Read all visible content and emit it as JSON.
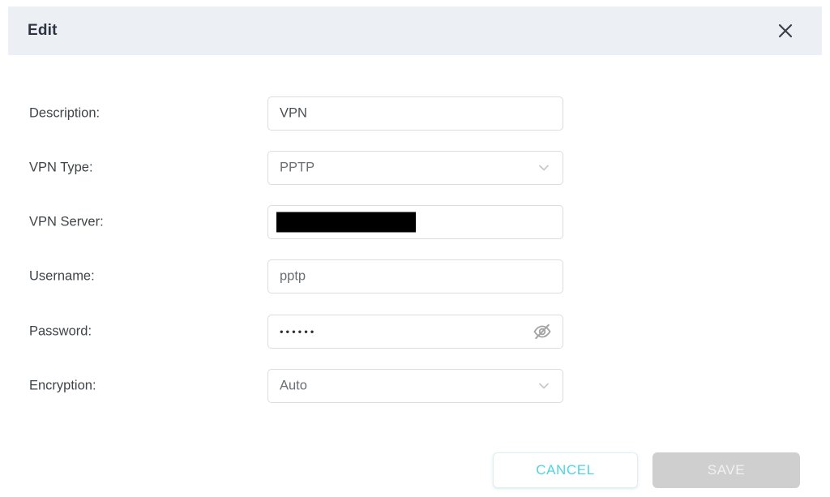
{
  "dialog": {
    "title": "Edit",
    "close_icon": "close-x-icon"
  },
  "form": {
    "rows": [
      {
        "label": "Description:",
        "type": "text",
        "value": "VPN",
        "name": "description"
      },
      {
        "label": "VPN Type:",
        "type": "select",
        "value": "PPTP",
        "name": "vpn-type",
        "chevron_icon": "chevron-down-icon"
      },
      {
        "label": "VPN Server:",
        "type": "redacted",
        "value": "",
        "name": "vpn-server"
      },
      {
        "label": "Username:",
        "type": "text",
        "value": "pptp",
        "name": "username"
      },
      {
        "label": "Password:",
        "type": "password",
        "value": "••••••",
        "name": "password",
        "toggle_icon": "eye-slash-icon"
      },
      {
        "label": "Encryption:",
        "type": "select",
        "value": "Auto",
        "name": "encryption",
        "chevron_icon": "chevron-down-icon"
      }
    ]
  },
  "footer": {
    "cancel_label": "CANCEL",
    "save_label": "SAVE"
  },
  "colors": {
    "header_bg": "#eceff4",
    "title_text": "#2c3440",
    "label_text": "#3f4447",
    "field_border": "#dcdcdc",
    "accent_cyan": "#4fd3e3",
    "save_disabled_bg": "#cfcfcf",
    "redaction": "#000000"
  }
}
